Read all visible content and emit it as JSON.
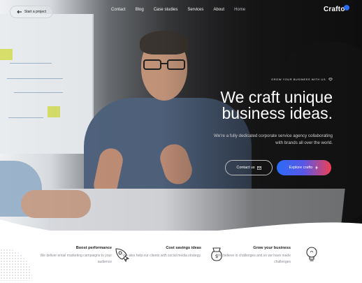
{
  "nav": {
    "logo_text": "Crafto",
    "start_project_label": "Start a project",
    "items": [
      {
        "label": "Contact"
      },
      {
        "label": "Blog"
      },
      {
        "label": "Case studies"
      },
      {
        "label": "Services"
      },
      {
        "label": "About"
      },
      {
        "label": "Home"
      }
    ]
  },
  "hero": {
    "eyebrow": "GROW YOUR BUSINESS WITH US",
    "headline_line1": "We craft unique",
    "headline_line2": "business ideas.",
    "subtitle": "We're a fully dedicated corporate service agency collaborating with brands all over the world.",
    "explore_label": "Explore crafto",
    "contact_label": "Contact us"
  },
  "features": [
    {
      "title": "Grow your business",
      "description": "We believe in challenges and so we have made challenges",
      "icon": "lightbulb-icon"
    },
    {
      "title": "Cost savings ideas",
      "description": "We also help our clients with social media strategy.",
      "icon": "money-bag-icon"
    },
    {
      "title": "Boost performance",
      "description": "We deliver email marketing campaigns to your audience",
      "icon": "rocket-icon"
    }
  ],
  "colors": {
    "accent_blue": "#2b6cf6",
    "accent_red": "#ef3f55"
  }
}
